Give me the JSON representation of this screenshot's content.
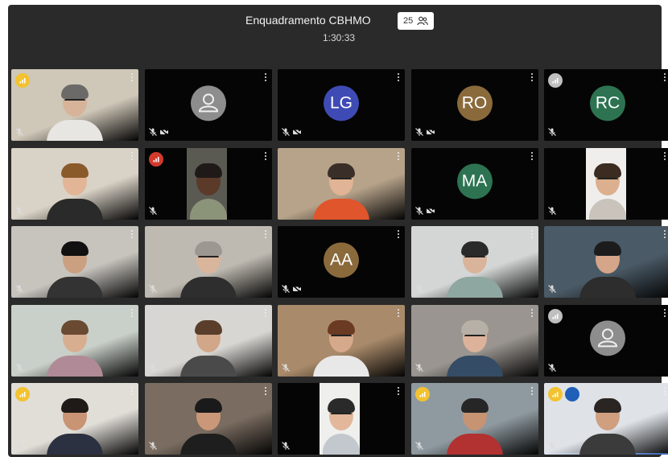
{
  "meeting": {
    "title": "Enquadramento CBHMO",
    "participant_count": "25",
    "elapsed": "1:30:33"
  },
  "colors": {
    "window_bg": "#2a2a2a",
    "active_border": "#3b7be8",
    "badge_yellow": "#f2c230",
    "badge_red": "#d23a2c",
    "badge_gray": "#bfbfbf"
  },
  "tiles": [
    {
      "kind": "video",
      "name": "participant-1",
      "bg": "#cfc7b8",
      "skin": "#d7b39a",
      "hair": "#6b6a68",
      "shirt": "#e8e6e2",
      "glasses": true,
      "badge": "yellow",
      "mic_off": true,
      "cam_off": false
    },
    {
      "kind": "default",
      "name": "participant-2",
      "mic_off": true,
      "cam_off": true
    },
    {
      "kind": "initials",
      "name": "participant-LG",
      "initials": "LG",
      "color": "#3f4bb5",
      "mic_off": true,
      "cam_off": true
    },
    {
      "kind": "initials",
      "name": "participant-RO",
      "initials": "RO",
      "color": "#8a6a3b",
      "mic_off": true,
      "cam_off": true
    },
    {
      "kind": "initials",
      "name": "participant-RC",
      "initials": "RC",
      "color": "#2d7352",
      "badge": "gray",
      "mic_off": true,
      "cam_off": false
    },
    {
      "kind": "video",
      "name": "participant-6",
      "bg": "#d9d2c6",
      "skin": "#e2b596",
      "hair": "#8a5a2b",
      "shirt": "#2a2a2a",
      "glasses": false,
      "mic_off": true,
      "cam_off": false
    },
    {
      "kind": "video",
      "name": "participant-7",
      "bg": "#5a5a52",
      "skin": "#5b3a2a",
      "hair": "#1f1a17",
      "shirt": "#8b9478",
      "glasses": false,
      "badge": "red",
      "mic_off": true,
      "cam_off": false,
      "narrow": true
    },
    {
      "kind": "video",
      "name": "participant-8",
      "bg": "#b7a38a",
      "skin": "#e0b494",
      "hair": "#3a2f28",
      "shirt": "#e0552c",
      "glasses": true,
      "mic_off": false,
      "cam_off": false
    },
    {
      "kind": "initials",
      "name": "participant-MA",
      "initials": "MA",
      "color": "#2d7352",
      "mic_off": true,
      "cam_off": true
    },
    {
      "kind": "video",
      "name": "participant-10",
      "bg": "#efeeec",
      "skin": "#dcb08f",
      "hair": "#3b2b20",
      "shirt": "#c9c3bb",
      "glasses": true,
      "mic_off": true,
      "cam_off": false,
      "narrow": true
    },
    {
      "kind": "video",
      "name": "participant-11",
      "bg": "#c7c4be",
      "skin": "#caa080",
      "hair": "#111111",
      "shirt": "#333333",
      "glasses": false,
      "mic_off": true,
      "cam_off": false
    },
    {
      "kind": "video",
      "name": "participant-12",
      "bg": "#bfbab1",
      "skin": "#d9b59c",
      "hair": "#9c9790",
      "shirt": "#2e2e2e",
      "glasses": true,
      "mic_off": true,
      "cam_off": false
    },
    {
      "kind": "initials",
      "name": "participant-AA",
      "initials": "AA",
      "color": "#8a6a3b",
      "mic_off": true,
      "cam_off": true
    },
    {
      "kind": "video",
      "name": "participant-14",
      "bg": "#d4d6d6",
      "skin": "#d9b49a",
      "hair": "#2a2a2a",
      "shirt": "#8fa7a1",
      "glasses": true,
      "mic_off": true,
      "cam_off": false
    },
    {
      "kind": "video",
      "name": "participant-15",
      "bg": "#4a5a66",
      "skin": "#d5a58a",
      "hair": "#1c1c1c",
      "shirt": "#2d2d2d",
      "glasses": false,
      "mic_off": true,
      "cam_off": false
    },
    {
      "kind": "video",
      "name": "participant-16",
      "bg": "#c9cfc9",
      "skin": "#d8ae90",
      "hair": "#6a4a33",
      "shirt": "#b08b97",
      "glasses": false,
      "mic_off": true,
      "cam_off": false
    },
    {
      "kind": "video",
      "name": "participant-17",
      "bg": "#d8d6d2",
      "skin": "#d2a689",
      "hair": "#5a3d2b",
      "shirt": "#4a4a4a",
      "glasses": false,
      "mic_off": true,
      "cam_off": false
    },
    {
      "kind": "video",
      "name": "participant-18",
      "bg": "#a98a6a",
      "skin": "#d6a98a",
      "hair": "#6a3a22",
      "shirt": "#e8e8e8",
      "glasses": true,
      "mic_off": true,
      "cam_off": false
    },
    {
      "kind": "video",
      "name": "participant-19",
      "bg": "#9a9590",
      "skin": "#ddb29a",
      "hair": "#b7b0a6",
      "shirt": "#354c66",
      "glasses": true,
      "mic_off": true,
      "cam_off": false
    },
    {
      "kind": "default",
      "name": "participant-20",
      "badge": "gray",
      "mic_off": true,
      "cam_off": false
    },
    {
      "kind": "video",
      "name": "participant-21",
      "bg": "#e1ded8",
      "skin": "#c99473",
      "hair": "#1f1a17",
      "shirt": "#2b3140",
      "glasses": false,
      "badge": "yellow",
      "mic_off": true,
      "cam_off": false
    },
    {
      "kind": "video",
      "name": "participant-22",
      "bg": "#7a6c60",
      "skin": "#ca9878",
      "hair": "#1a1a1a",
      "shirt": "#1e1e1e",
      "glasses": false,
      "mic_off": true,
      "cam_off": false
    },
    {
      "kind": "video",
      "name": "participant-23",
      "bg": "#efefee",
      "skin": "#e2b79a",
      "hair": "#2a2a2a",
      "shirt": "#c3c8ce",
      "glasses": true,
      "mic_off": true,
      "cam_off": false,
      "narrow": true
    },
    {
      "kind": "video",
      "name": "participant-24",
      "bg": "#8f9aa0",
      "skin": "#c69373",
      "hair": "#262626",
      "shirt": "#b23131",
      "glasses": false,
      "badge": "yellow",
      "mic_off": true,
      "cam_off": false
    },
    {
      "kind": "video",
      "name": "participant-25",
      "bg": "#dfe3e8",
      "skin": "#cf9f80",
      "hair": "#2a2522",
      "shirt": "#3b3b3b",
      "glasses": false,
      "badge": "yellow",
      "caption": true,
      "mic_off": true,
      "cam_off": false,
      "active": true
    }
  ]
}
